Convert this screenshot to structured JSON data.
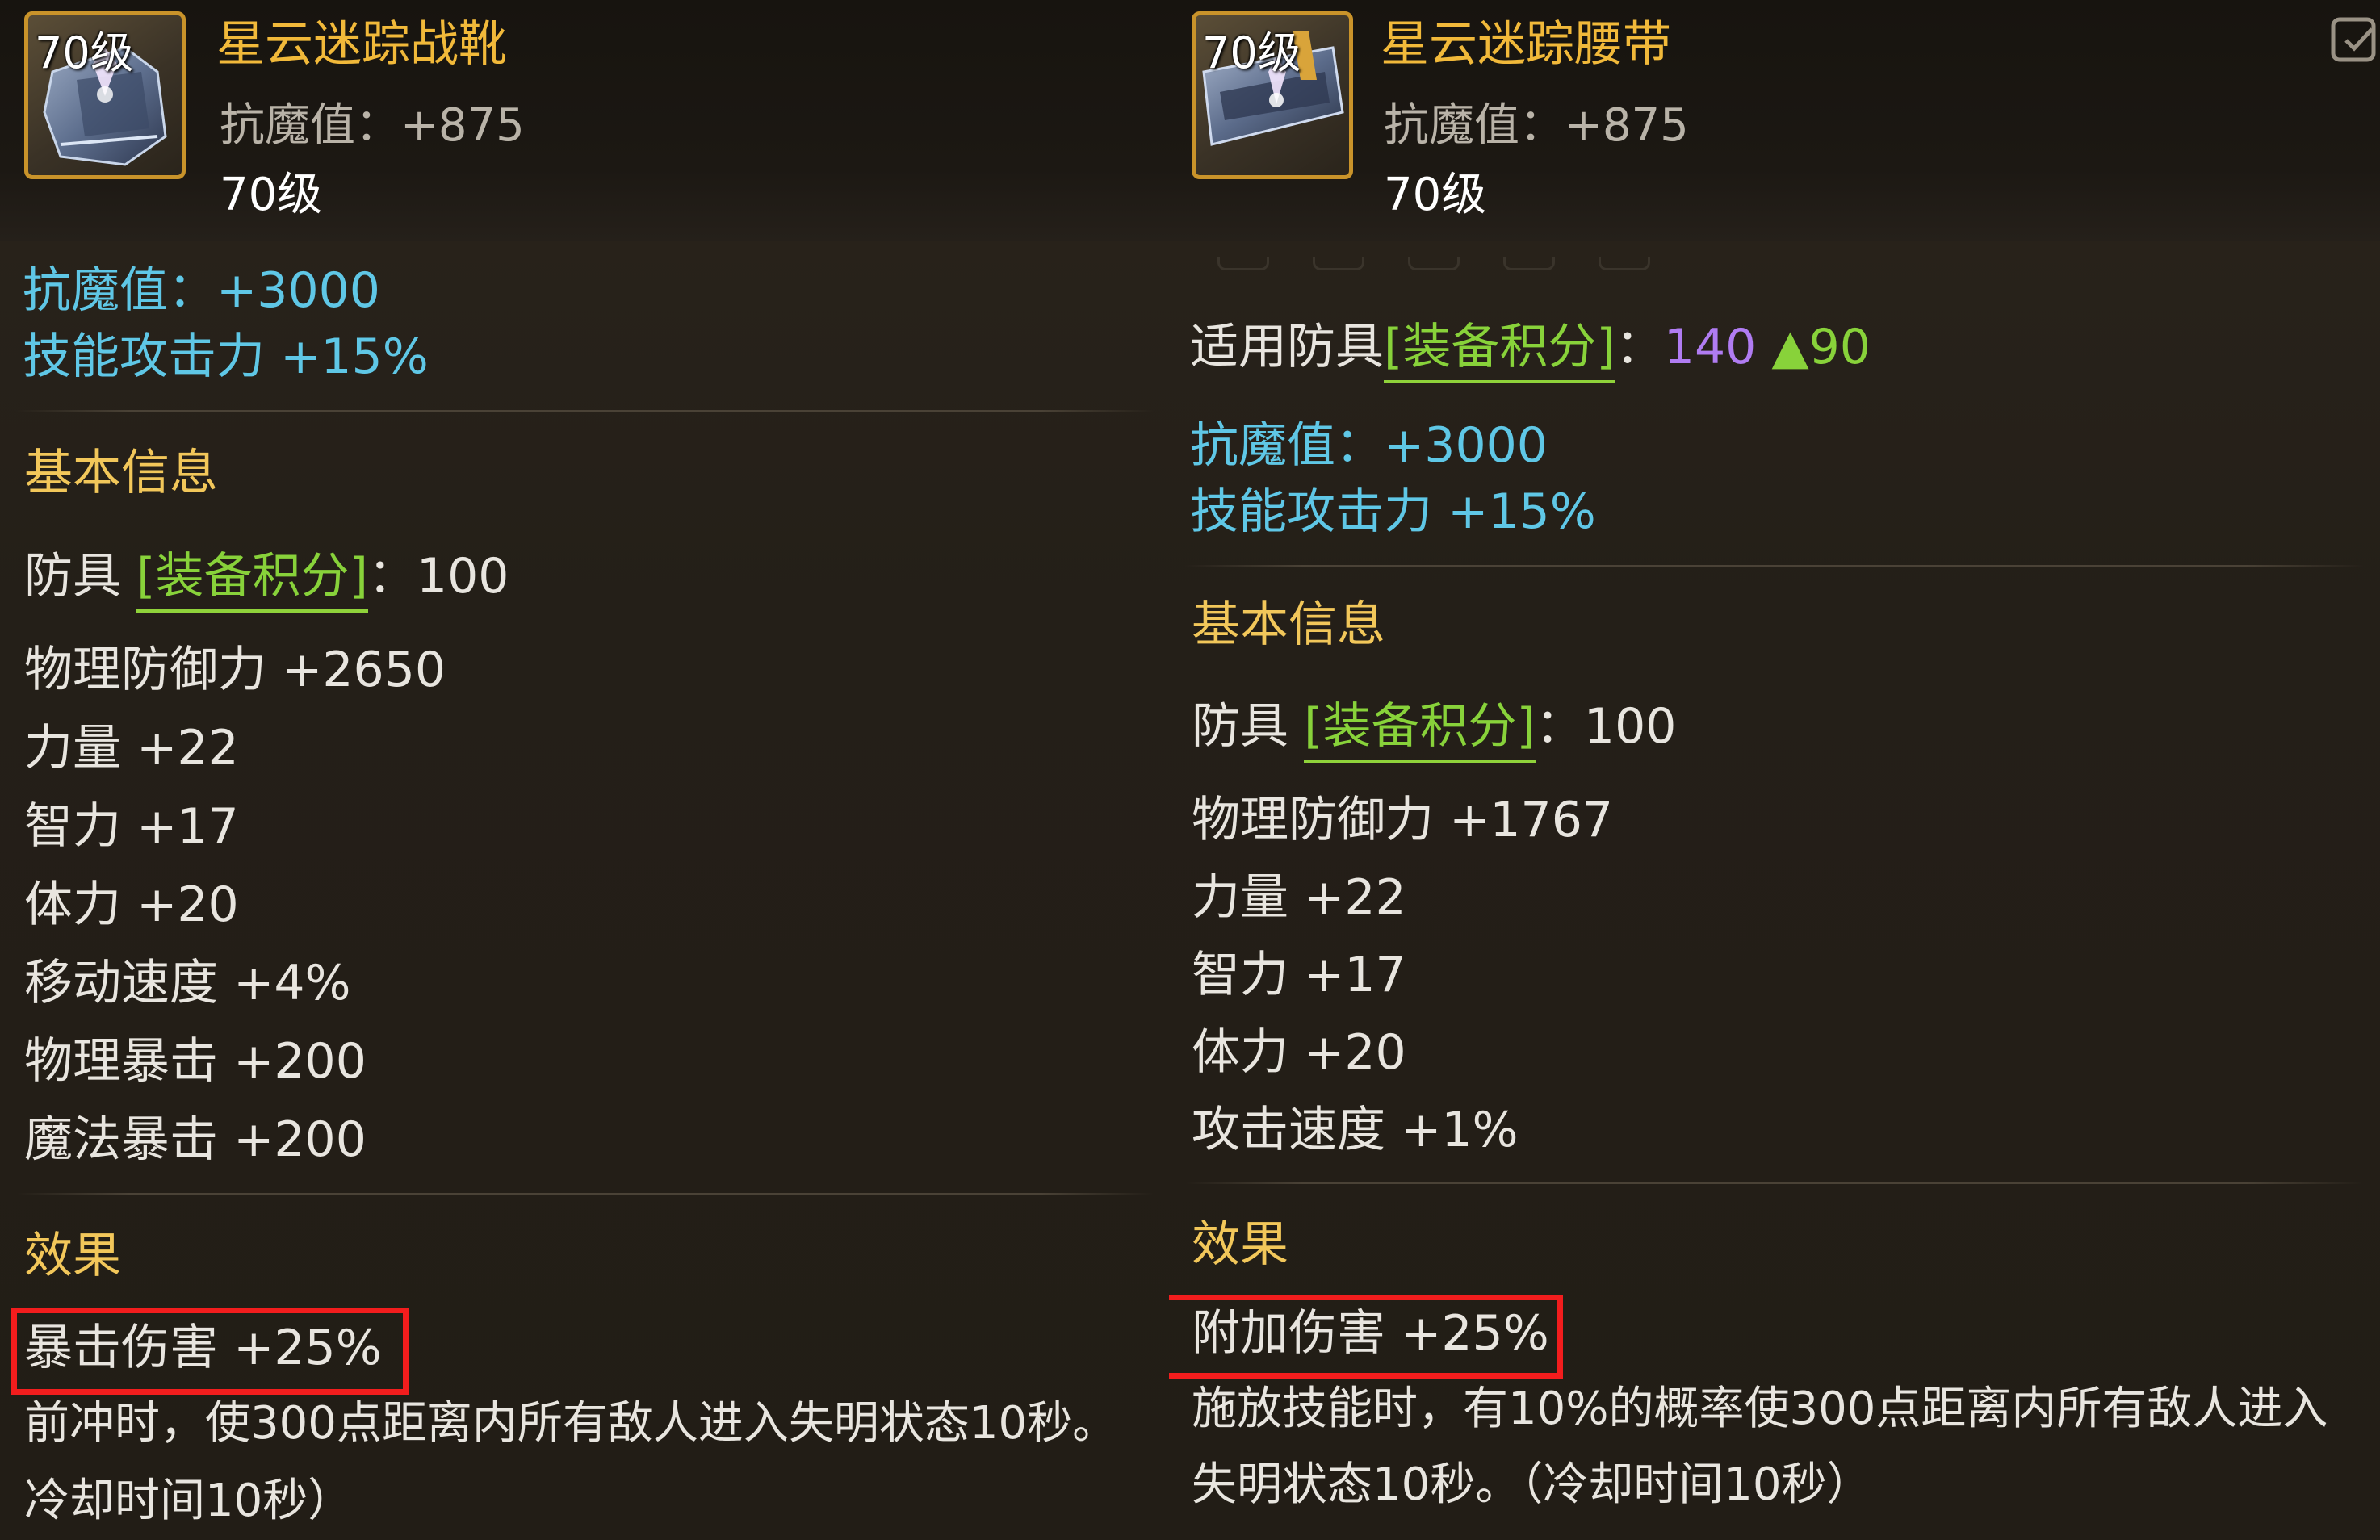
{
  "left": {
    "item": {
      "level_badge": "70级",
      "name": "星云迷踪战靴",
      "resist": "抗魔值：+875",
      "level": "70级"
    },
    "bonus": [
      "抗魔值：+3000",
      "技能攻击力 +15%"
    ],
    "basic_header": "基本信息",
    "armor_prefix": "防具",
    "armor_score_label": "[装备积分]",
    "armor_score_suffix": "：100",
    "stats": [
      "物理防御力 +2650",
      "力量 +22",
      "智力 +17",
      "体力 +20",
      "移动速度 +4%",
      "物理暴击 +200",
      "魔法暴击 +200"
    ],
    "effect_header": "效果",
    "effect_main": "暴击伤害 +25%",
    "effect_desc_1": "前冲时，使300点距离内所有敌人进入失明状态10秒。",
    "effect_desc_2": "冷却时间10秒）"
  },
  "right": {
    "item": {
      "level_badge": "70级",
      "name": "星云迷踪腰带",
      "resist": "抗魔值：+875",
      "level": "70级"
    },
    "applicable_prefix": "适用防具",
    "applicable_score_label": "[装备积分]",
    "applicable_colon": "：",
    "applicable_value": "140",
    "applicable_increase": "▲90",
    "bonus": [
      "抗魔值：+3000",
      "技能攻击力 +15%"
    ],
    "basic_header": "基本信息",
    "armor_prefix": "防具",
    "armor_score_label": "[装备积分]",
    "armor_score_suffix": "：100",
    "stats": [
      "物理防御力 +1767",
      "力量 +22",
      "智力 +17",
      "体力 +20",
      "攻击速度 +1%"
    ],
    "effect_header": "效果",
    "effect_main": "附加伤害 +25%",
    "effect_desc_1": "施放技能时，有10%的概率使300点距离内所有敌人进入",
    "effect_desc_2": "失明状态10秒。（冷却时间10秒）"
  },
  "colors": {
    "title": "#f1b93a",
    "bonus": "#5fc7e6",
    "header": "#f2c75a",
    "score_label": "#88d23a",
    "score_value": "#b07cf2",
    "highlight": "#f21d1d"
  }
}
